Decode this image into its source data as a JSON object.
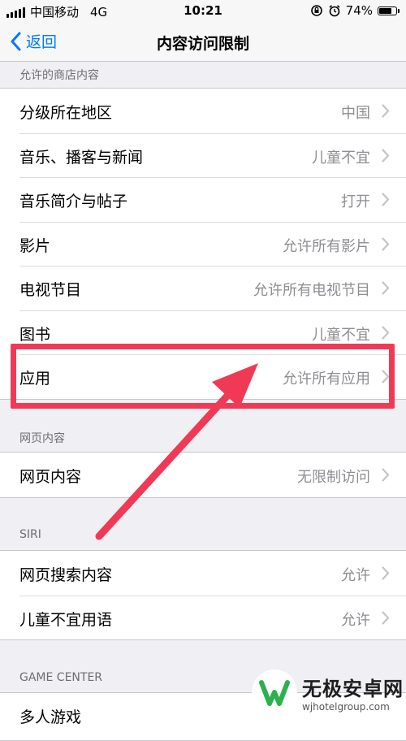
{
  "status_bar": {
    "carrier": "中国移动",
    "network": "4G",
    "time": "10:21",
    "battery_percent_label": "74%",
    "battery_level": 0.74,
    "icons": [
      "signal-icon",
      "rotation-lock-icon",
      "alarm-icon",
      "battery-icon"
    ]
  },
  "nav": {
    "back_label": "返回",
    "title": "内容访问限制"
  },
  "sections": [
    {
      "header": "允许的商店内容",
      "rows": [
        {
          "label": "分级所在地区",
          "value": "中国"
        },
        {
          "label": "音乐、播客与新闻",
          "value": "儿童不宜"
        },
        {
          "label": "音乐简介与帖子",
          "value": "打开"
        },
        {
          "label": "影片",
          "value": "允许所有影片"
        },
        {
          "label": "电视节目",
          "value": "允许所有电视节目"
        },
        {
          "label": "图书",
          "value": "儿童不宜"
        },
        {
          "label": "应用",
          "value": "允许所有应用"
        }
      ]
    },
    {
      "header": "网页内容",
      "rows": [
        {
          "label": "网页内容",
          "value": "无限制访问"
        }
      ]
    },
    {
      "header": "SIRI",
      "rows": [
        {
          "label": "网页搜索内容",
          "value": "允许"
        },
        {
          "label": "儿童不宜用语",
          "value": "允许"
        }
      ]
    },
    {
      "header": "GAME CENTER",
      "rows": [
        {
          "label": "多人游戏",
          "value": ""
        }
      ]
    }
  ],
  "annotation": {
    "highlight_color": "#f03a55"
  },
  "watermark": {
    "title": "无极安卓网",
    "url": "wjhotelgroup.com"
  }
}
